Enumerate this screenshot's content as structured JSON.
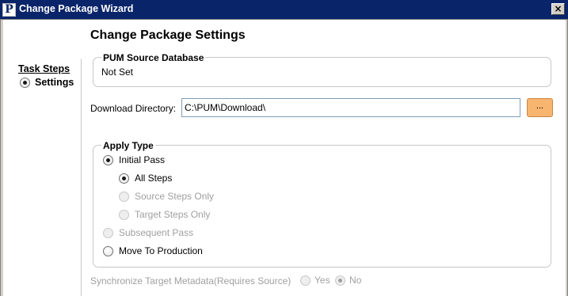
{
  "window": {
    "title": "Change Package Wizard",
    "app_icon_letter": "P",
    "close_symbol": "×"
  },
  "steps": {
    "heading": "Task Steps",
    "items": [
      {
        "label": "Settings",
        "selected": true
      }
    ]
  },
  "page": {
    "heading": "Change Package Settings"
  },
  "source_db": {
    "legend": "PUM Source Database",
    "value": "Not Set"
  },
  "download": {
    "label": "Download Directory:",
    "value": "C:\\PUM\\Download\\",
    "browse_label": "..."
  },
  "apply_type": {
    "legend": "Apply Type",
    "initial_pass": "Initial Pass",
    "all_steps": "All Steps",
    "source_steps_only": "Source Steps Only",
    "target_steps_only": "Target Steps Only",
    "subsequent_pass": "Subsequent Pass",
    "move_to_production": "Move To Production"
  },
  "sync": {
    "label": "Synchronize Target Metadata(Requires Source)",
    "yes": "Yes",
    "no": "No"
  },
  "colors": {
    "titlebar": "#0a246a",
    "browse_button": "#f8b56f",
    "disabled_text": "#a0a0a0",
    "group_border": "#c8c8c8"
  }
}
